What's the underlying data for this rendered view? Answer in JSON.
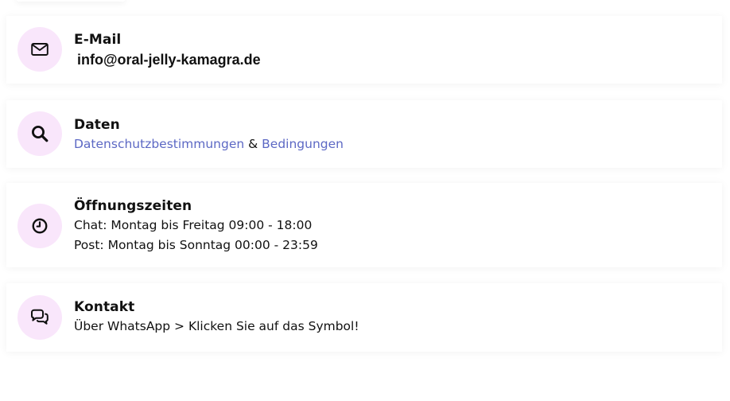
{
  "contacts": {
    "email": {
      "icon": "envelope-icon",
      "title": "E-Mail",
      "value": "info@oral-jelly-kamagra.de"
    },
    "data": {
      "icon": "search-icon",
      "title": "Daten",
      "privacy_link": "Datenschutzbestimmungen",
      "separator": " & ",
      "terms_link": "Bedingungen"
    },
    "hours": {
      "icon": "clock-icon",
      "title": "Öffnungszeiten",
      "chat": "Chat: Montag bis Freitag 09:00 - 18:00",
      "post": "Post: Montag bis Sonntag 00:00 - 23:59"
    },
    "contact": {
      "icon": "chat-bubbles-icon",
      "title": "Kontakt",
      "text": "Über WhatsApp > Klicken Sie auf das Symbol!"
    }
  },
  "colors": {
    "icon_background": "#f9e6fb",
    "link": "#5c68c4",
    "text": "#111111"
  }
}
